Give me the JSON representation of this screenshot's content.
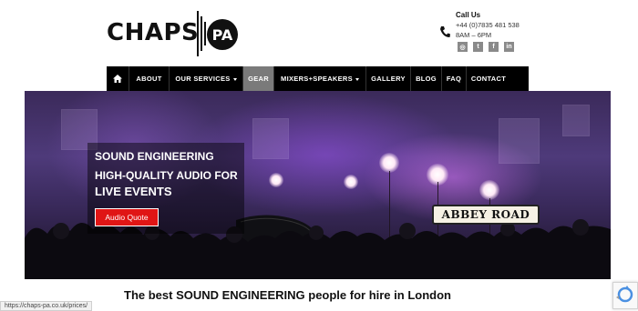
{
  "header": {
    "logo_text": "CHAPS",
    "logo_badge": "PA",
    "contact_label": "Call Us",
    "phone": "+44 (0)7835 481 538",
    "hours": "8AM – 6PM",
    "social_icons": [
      "instagram-icon",
      "twitter-icon",
      "facebook-icon",
      "linkedin-icon"
    ],
    "social_glyphs": [
      "◎",
      "t",
      "f",
      "in"
    ]
  },
  "nav": {
    "home_icon": "home-icon",
    "items": [
      {
        "label": "ABOUT"
      },
      {
        "label": "OUR SERVICES",
        "dropdown": true
      },
      {
        "label": "GEAR",
        "active": true
      },
      {
        "label": "MIXERS+SPEAKERS",
        "dropdown": true
      },
      {
        "label": "GALLERY"
      },
      {
        "label": "BLOG"
      },
      {
        "label": "FAQ"
      },
      {
        "label": "CONTACT"
      }
    ]
  },
  "hero": {
    "line1": "SOUND ENGINEERING",
    "line2": "HIGH-QUALITY AUDIO FOR",
    "line3": "LIVE EVENTS",
    "button_label": "Audio Quote",
    "sign_text": "ABBEY ROAD"
  },
  "tagline": "The best SOUND ENGINEERING people for hire in London",
  "status_url": "https://chaps-pa.co.uk/prices/",
  "colors": {
    "accent_red": "#e01515",
    "nav_bg": "#000000",
    "nav_active": "#7a7a7a"
  }
}
